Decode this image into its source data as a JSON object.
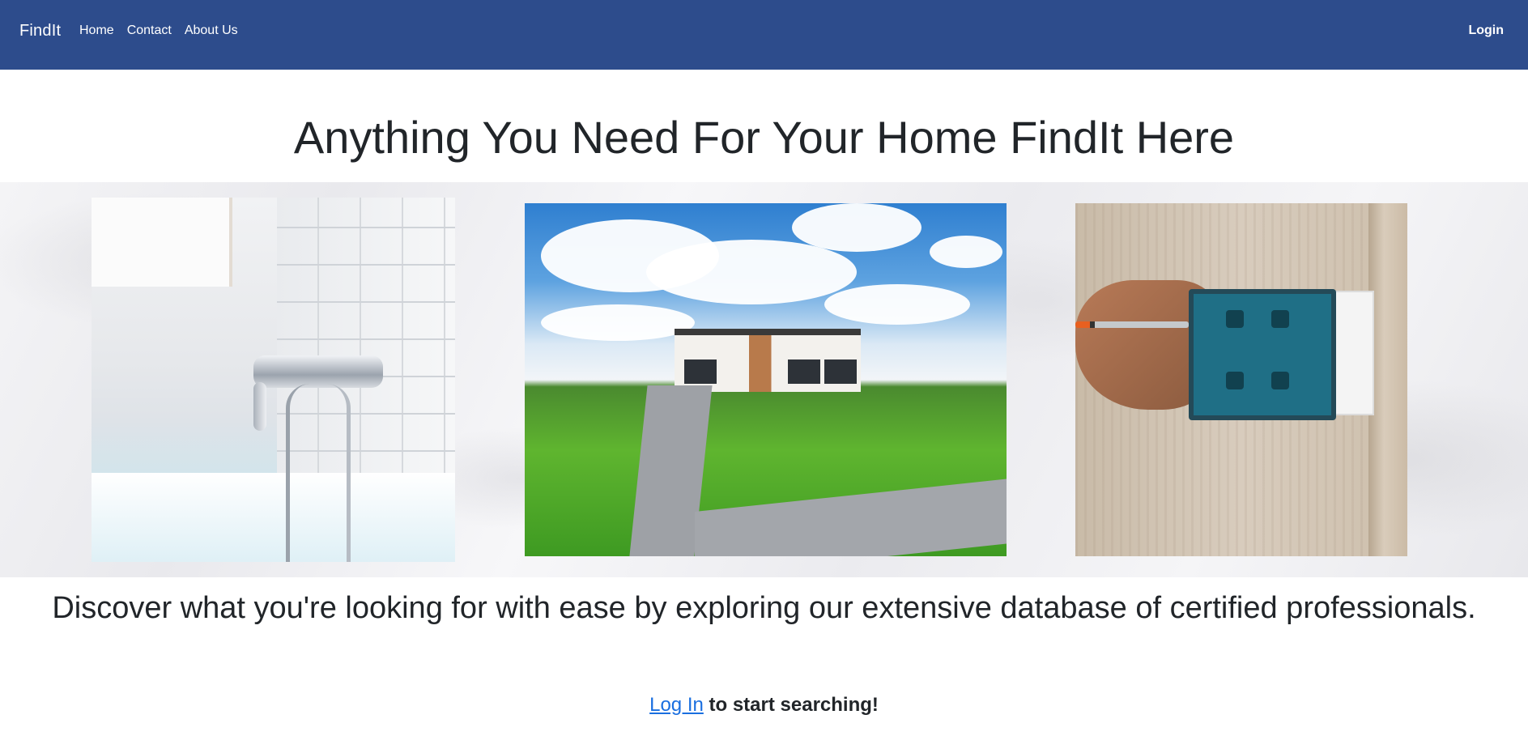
{
  "navbar": {
    "brand": "FindIt",
    "links": [
      "Home",
      "Contact",
      "About Us"
    ],
    "login": "Login",
    "background_color": "#2d4c8c"
  },
  "hero": {
    "title_prefix": "Anything You Need For Your Home ",
    "title_brand": "FindIt",
    "title_suffix": " Here"
  },
  "gallery": {
    "images": [
      {
        "subject": "bathtub faucet"
      },
      {
        "subject": "modern house with lawn"
      },
      {
        "subject": "electrical outlet installation"
      }
    ]
  },
  "tagline": "Discover what you're looking for with ease by exploring our extensive database of certified professionals.",
  "cta": {
    "link_text": "Log In",
    "suffix_text": " to start searching!",
    "link_color": "#1a6fe0"
  }
}
